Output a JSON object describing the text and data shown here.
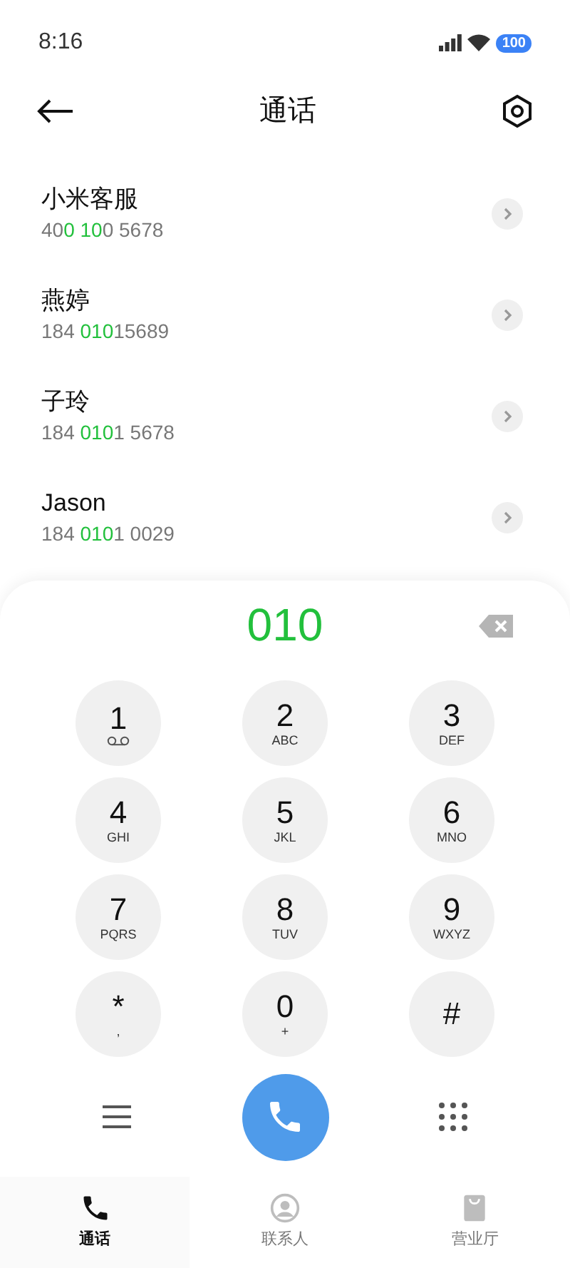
{
  "status_bar": {
    "time": "8:16",
    "battery": "100"
  },
  "header": {
    "title": "通话"
  },
  "contacts": [
    {
      "name": "小米客服",
      "number": [
        {
          "text": "40",
          "match": false
        },
        {
          "text": "0 10",
          "match": true
        },
        {
          "text": "0 5678",
          "match": false
        }
      ]
    },
    {
      "name": "燕婷",
      "number": [
        {
          "text": "184 ",
          "match": false
        },
        {
          "text": "010",
          "match": true
        },
        {
          "text": "15689",
          "match": false
        }
      ]
    },
    {
      "name": "子玲",
      "number": [
        {
          "text": "184 ",
          "match": false
        },
        {
          "text": "010",
          "match": true
        },
        {
          "text": "1 5678",
          "match": false
        }
      ]
    },
    {
      "name": "Jason",
      "number": [
        {
          "text": "184 ",
          "match": false
        },
        {
          "text": "010",
          "match": true
        },
        {
          "text": "1 0029",
          "match": false
        }
      ]
    }
  ],
  "dialer": {
    "entered": "010",
    "keys": [
      {
        "digit": "1",
        "kind": "voicemail"
      },
      {
        "digit": "2",
        "sub": "ABC",
        "kind": "text"
      },
      {
        "digit": "3",
        "sub": "DEF",
        "kind": "text"
      },
      {
        "digit": "4",
        "sub": "GHI",
        "kind": "text"
      },
      {
        "digit": "5",
        "sub": "JKL",
        "kind": "text"
      },
      {
        "digit": "6",
        "sub": "MNO",
        "kind": "text"
      },
      {
        "digit": "7",
        "sub": "PQRS",
        "kind": "text"
      },
      {
        "digit": "8",
        "sub": "TUV",
        "kind": "text"
      },
      {
        "digit": "9",
        "sub": "WXYZ",
        "kind": "text"
      },
      {
        "digit": "*",
        "sub": ",",
        "kind": "text"
      },
      {
        "digit": "0",
        "sub": "+",
        "kind": "text"
      },
      {
        "digit": "#",
        "kind": "plain"
      }
    ]
  },
  "tabs": [
    {
      "label": "通话",
      "kind": "phone",
      "selected": true
    },
    {
      "label": "联系人",
      "kind": "contact",
      "selected": false
    },
    {
      "label": "营业厅",
      "kind": "store",
      "selected": false
    }
  ]
}
